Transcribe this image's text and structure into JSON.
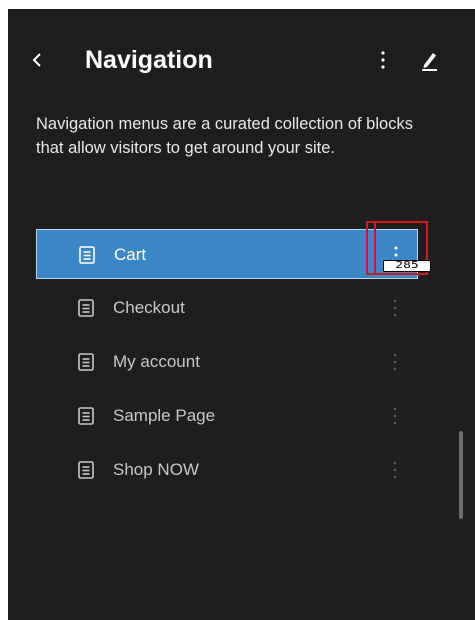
{
  "header": {
    "back_icon": "chevron-left-icon",
    "title": "Navigation",
    "options_icon": "kebab-vertical-icon",
    "edit_icon": "pencil-icon"
  },
  "description": "Navigation menus are a curated collection of blocks that allow visitors to get around your site.",
  "nav_items": [
    {
      "label": "Cart",
      "icon": "page-icon",
      "selected": true
    },
    {
      "label": "Checkout",
      "icon": "page-icon",
      "selected": false
    },
    {
      "label": "My account",
      "icon": "page-icon",
      "selected": false
    },
    {
      "label": "Sample Page",
      "icon": "page-icon",
      "selected": false
    },
    {
      "label": "Shop NOW",
      "icon": "page-icon",
      "selected": false
    }
  ],
  "overlay_tag": "285",
  "colors": {
    "panel_bg": "#1e1e1e",
    "selected_bg": "#3a86c7",
    "highlight_border": "#d11b1b"
  }
}
